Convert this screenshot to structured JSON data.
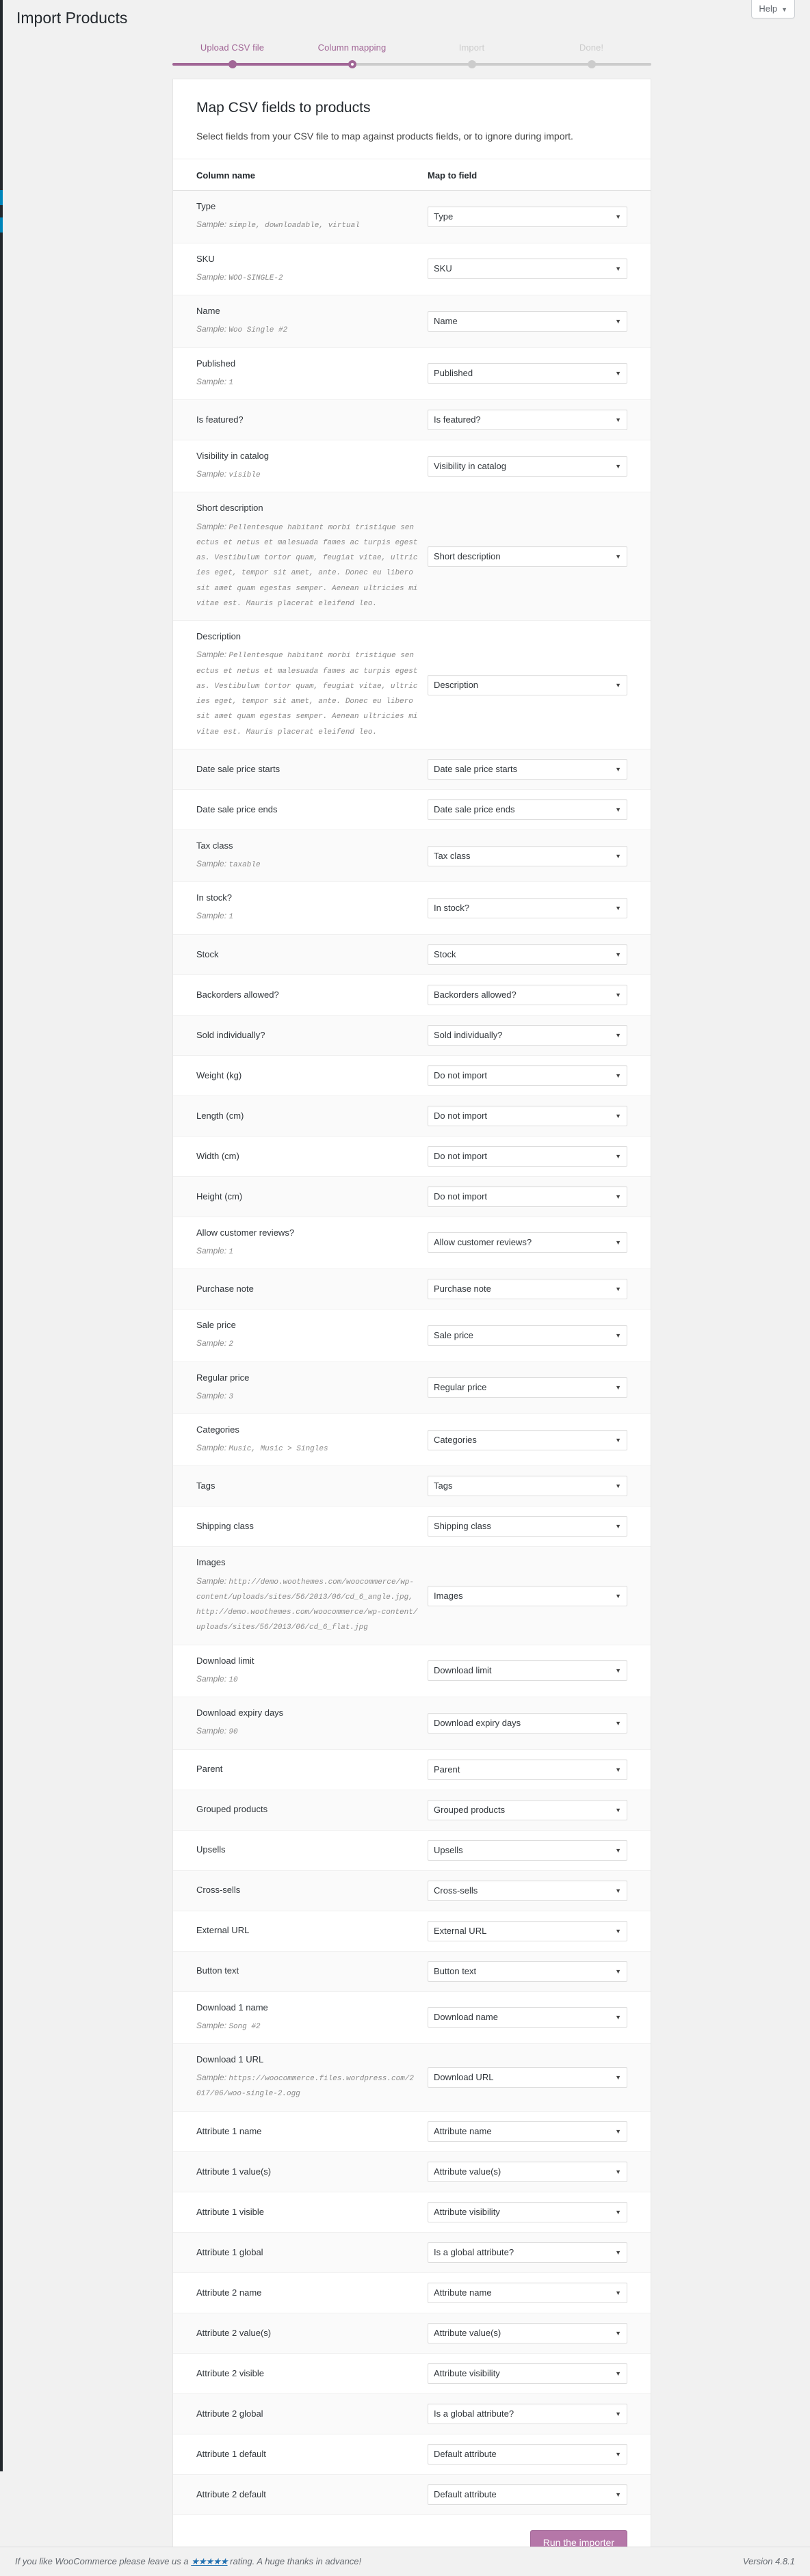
{
  "page": {
    "title": "Import Products",
    "help_label": "Help",
    "help_caret": "chevron-down-icon"
  },
  "stepper": {
    "steps": [
      {
        "label": "Upload CSV file",
        "state": "done"
      },
      {
        "label": "Column mapping",
        "state": "current"
      },
      {
        "label": "Import",
        "state": "todo"
      },
      {
        "label": "Done!",
        "state": "todo"
      }
    ],
    "accent_color": "#a16696",
    "inactive_color": "#cccccc"
  },
  "card": {
    "heading": "Map CSV fields to products",
    "subheading": "Select fields from your CSV file to map against products fields, or to ignore during import.",
    "columns": {
      "name": "Column name",
      "map": "Map to field"
    },
    "run_button": "Run the importer",
    "sample_prefix": "Sample:",
    "rows": [
      {
        "name": "Type",
        "sample": "simple, downloadable, virtual",
        "value": "Type"
      },
      {
        "name": "SKU",
        "sample": "WOO-SINGLE-2",
        "value": "SKU"
      },
      {
        "name": "Name",
        "sample": "Woo Single #2",
        "value": "Name"
      },
      {
        "name": "Published",
        "sample": "1",
        "value": "Published"
      },
      {
        "name": "Is featured?",
        "sample": "",
        "value": "Is featured?"
      },
      {
        "name": "Visibility in catalog",
        "sample": "visible",
        "value": "Visibility in catalog"
      },
      {
        "name": "Short description",
        "sample": "Pellentesque habitant morbi tristique senectus et netus et malesuada fames ac turpis egestas. Vestibulum tortor quam, feugiat vitae, ultricies eget, tempor sit amet, ante. Donec eu libero sit amet quam egestas semper. Aenean ultricies mi vitae est. Mauris placerat eleifend leo.",
        "value": "Short description"
      },
      {
        "name": "Description",
        "sample": "Pellentesque habitant morbi tristique senectus et netus et malesuada fames ac turpis egestas. Vestibulum tortor quam, feugiat vitae, ultricies eget, tempor sit amet, ante. Donec eu libero sit amet quam egestas semper. Aenean ultricies mi vitae est. Mauris placerat eleifend leo.",
        "value": "Description"
      },
      {
        "name": "Date sale price starts",
        "sample": "",
        "value": "Date sale price starts"
      },
      {
        "name": "Date sale price ends",
        "sample": "",
        "value": "Date sale price ends"
      },
      {
        "name": "Tax class",
        "sample": "taxable",
        "value": "Tax class"
      },
      {
        "name": "In stock?",
        "sample": "1",
        "value": "In stock?"
      },
      {
        "name": "Stock",
        "sample": "",
        "value": "Stock"
      },
      {
        "name": "Backorders allowed?",
        "sample": "",
        "value": "Backorders allowed?"
      },
      {
        "name": "Sold individually?",
        "sample": "",
        "value": "Sold individually?"
      },
      {
        "name": "Weight (kg)",
        "sample": "",
        "value": "Do not import"
      },
      {
        "name": "Length (cm)",
        "sample": "",
        "value": "Do not import"
      },
      {
        "name": "Width (cm)",
        "sample": "",
        "value": "Do not import"
      },
      {
        "name": "Height (cm)",
        "sample": "",
        "value": "Do not import"
      },
      {
        "name": "Allow customer reviews?",
        "sample": "1",
        "value": "Allow customer reviews?"
      },
      {
        "name": "Purchase note",
        "sample": "",
        "value": "Purchase note"
      },
      {
        "name": "Sale price",
        "sample": "2",
        "value": "Sale price"
      },
      {
        "name": "Regular price",
        "sample": "3",
        "value": "Regular price"
      },
      {
        "name": "Categories",
        "sample": "Music, Music > Singles",
        "value": "Categories"
      },
      {
        "name": "Tags",
        "sample": "",
        "value": "Tags"
      },
      {
        "name": "Shipping class",
        "sample": "",
        "value": "Shipping class"
      },
      {
        "name": "Images",
        "sample": "http://demo.woothemes.com/woocommerce/wp-content/uploads/sites/56/2013/06/cd_6_angle.jpg, http://demo.woothemes.com/woocommerce/wp-content/uploads/sites/56/2013/06/cd_6_flat.jpg",
        "value": "Images"
      },
      {
        "name": "Download limit",
        "sample": "10",
        "value": "Download limit"
      },
      {
        "name": "Download expiry days",
        "sample": "90",
        "value": "Download expiry days"
      },
      {
        "name": "Parent",
        "sample": "",
        "value": "Parent"
      },
      {
        "name": "Grouped products",
        "sample": "",
        "value": "Grouped products"
      },
      {
        "name": "Upsells",
        "sample": "",
        "value": "Upsells"
      },
      {
        "name": "Cross-sells",
        "sample": "",
        "value": "Cross-sells"
      },
      {
        "name": "External URL",
        "sample": "",
        "value": "External URL"
      },
      {
        "name": "Button text",
        "sample": "",
        "value": "Button text"
      },
      {
        "name": "Download 1 name",
        "sample": "Song #2",
        "value": "Download name"
      },
      {
        "name": "Download 1 URL",
        "sample": "https://woocommerce.files.wordpress.com/2017/06/woo-single-2.ogg",
        "value": "Download URL"
      },
      {
        "name": "Attribute 1 name",
        "sample": "",
        "value": "Attribute name"
      },
      {
        "name": "Attribute 1 value(s)",
        "sample": "",
        "value": "Attribute value(s)"
      },
      {
        "name": "Attribute 1 visible",
        "sample": "",
        "value": "Attribute visibility"
      },
      {
        "name": "Attribute 1 global",
        "sample": "",
        "value": "Is a global attribute?"
      },
      {
        "name": "Attribute 2 name",
        "sample": "",
        "value": "Attribute name"
      },
      {
        "name": "Attribute 2 value(s)",
        "sample": "",
        "value": "Attribute value(s)"
      },
      {
        "name": "Attribute 2 visible",
        "sample": "",
        "value": "Attribute visibility"
      },
      {
        "name": "Attribute 2 global",
        "sample": "",
        "value": "Is a global attribute?"
      },
      {
        "name": "Attribute 1 default",
        "sample": "",
        "value": "Default attribute"
      },
      {
        "name": "Attribute 2 default",
        "sample": "",
        "value": "Default attribute"
      }
    ]
  },
  "footer": {
    "text_before": "If you like WooCommerce please leave us a",
    "stars": "★★★★★",
    "text_after": "rating. A huge thanks in advance!",
    "version": "Version 4.8.1"
  }
}
